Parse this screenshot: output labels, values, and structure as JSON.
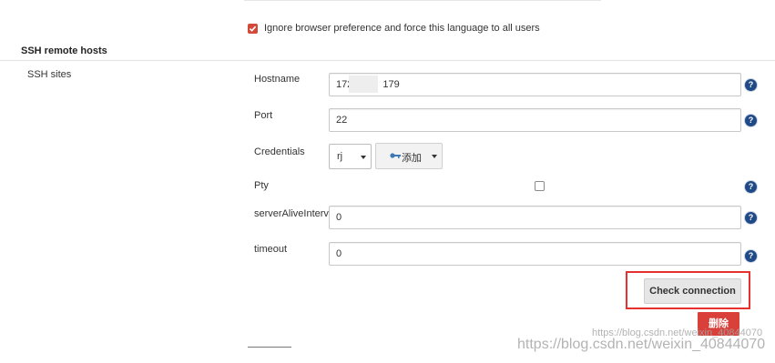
{
  "language": {
    "ignore_browser_label": "Ignore browser preference and force this language to all users",
    "ignore_browser_checked": true
  },
  "ssh": {
    "section_title": "SSH remote hosts",
    "sites_label": "SSH sites",
    "hostname_label": "Hostname",
    "hostname_value_start": "172.",
    "hostname_value_end": "179",
    "port_label": "Port",
    "port_value": "22",
    "credentials_label": "Credentials",
    "credentials_value": "rj",
    "add_button_label": "添加",
    "pty_label": "Pty",
    "pty_checked": false,
    "server_alive_label": "serverAliveInterval",
    "server_alive_value": "0",
    "timeout_label": "timeout",
    "timeout_value": "0",
    "help_glyph": "?",
    "check_connection_label": "Check connection",
    "delete_label": "删除"
  },
  "watermark": {
    "small": "https://blog.csdn.net/weixin_40844070",
    "large": "https://blog.csdn.net/weixin_40844070"
  },
  "colors": {
    "checkbox_accent": "#d24939",
    "help_icon": "#204a87",
    "highlight_border": "#e8312e",
    "delete_button": "#d9403a"
  },
  "icons": {
    "checked": "check-icon",
    "help": "help-icon",
    "key": "key-icon",
    "dropdown": "chevron-down-icon"
  }
}
